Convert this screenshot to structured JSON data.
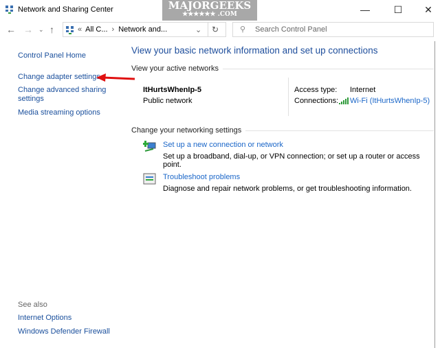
{
  "window": {
    "title": "Network and Sharing Center",
    "watermark": "MAJORGEEKS",
    "watermark_sub": "★★★★★★ .COM"
  },
  "address": {
    "prefix": "«",
    "crumbs": [
      "All C...",
      "Network and..."
    ]
  },
  "search": {
    "placeholder": "Search Control Panel"
  },
  "sidebar": {
    "items": [
      "Control Panel Home",
      "Change adapter settings",
      "Change advanced sharing settings",
      "Media streaming options"
    ],
    "see_also_label": "See also",
    "see_also": [
      "Internet Options",
      "Windows Defender Firewall"
    ]
  },
  "main": {
    "title": "View your basic network information and set up connections",
    "active_label": "View your active networks",
    "network": {
      "name": "ItHurtsWhenIp-5",
      "type": "Public network",
      "access_label": "Access type:",
      "access_value": "Internet",
      "connections_label": "Connections:",
      "connection_value": "Wi-Fi (ItHurtsWhenIp-5)"
    },
    "settings_label": "Change your networking settings",
    "tasks": [
      {
        "title": "Set up a new connection or network",
        "desc": "Set up a broadband, dial-up, or VPN connection; or set up a router or access point."
      },
      {
        "title": "Troubleshoot problems",
        "desc": "Diagnose and repair network problems, or get troubleshooting information."
      }
    ]
  },
  "colors": {
    "link": "#1a66c8",
    "annotation_arrow": "#e01010"
  }
}
